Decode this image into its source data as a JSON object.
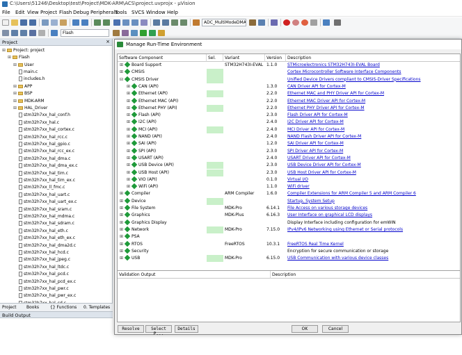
{
  "window": {
    "title": "C:\\Users\\51246\\Desktop\\test\\Project\\MDK-ARM\\ACS\\project.uvprojx - µVision"
  },
  "menu": [
    "File",
    "Edit",
    "View",
    "Project",
    "Flash",
    "Debug",
    "Peripherals",
    "Tools",
    "SVCS",
    "Window",
    "Help"
  ],
  "toolbar": {
    "target_combo": "ADC_MultiModeDMARec",
    "build_target": "Flash"
  },
  "project_panel": {
    "title": "Project",
    "tree": [
      {
        "label": "Project: project",
        "kind": "root",
        "indent": 0
      },
      {
        "label": "Flash",
        "kind": "folder",
        "indent": 1
      },
      {
        "label": "User",
        "kind": "folder",
        "indent": 2
      },
      {
        "label": "main.c",
        "kind": "file",
        "indent": 3
      },
      {
        "label": "includes.h",
        "kind": "file",
        "indent": 3
      },
      {
        "label": "APP",
        "kind": "folder",
        "indent": 2
      },
      {
        "label": "BSP",
        "kind": "folder",
        "indent": 2
      },
      {
        "label": "MDK-ARM",
        "kind": "folder",
        "indent": 2
      },
      {
        "label": "HAL_Driver",
        "kind": "folder",
        "indent": 2
      },
      {
        "label": "stm32h7xx_hal_conf.h",
        "kind": "file",
        "indent": 3
      },
      {
        "label": "stm32h7xx_hal.c",
        "kind": "file",
        "indent": 3
      },
      {
        "label": "stm32h7xx_hal_cortex.c",
        "kind": "file",
        "indent": 3
      },
      {
        "label": "stm32h7xx_hal_rcc.c",
        "kind": "file",
        "indent": 3
      },
      {
        "label": "stm32h7xx_hal_gpio.c",
        "kind": "file",
        "indent": 3
      },
      {
        "label": "stm32h7xx_hal_rcc_ex.c",
        "kind": "file",
        "indent": 3
      },
      {
        "label": "stm32h7xx_hal_dma.c",
        "kind": "file",
        "indent": 3
      },
      {
        "label": "stm32h7xx_hal_dma_ex.c",
        "kind": "file",
        "indent": 3
      },
      {
        "label": "stm32h7xx_hal_tim.c",
        "kind": "file",
        "indent": 3
      },
      {
        "label": "stm32h7xx_hal_tim_ex.c",
        "kind": "file",
        "indent": 3
      },
      {
        "label": "stm32h7xx_ll_fmc.c",
        "kind": "file",
        "indent": 3
      },
      {
        "label": "stm32h7xx_hal_uart.c",
        "kind": "file",
        "indent": 3
      },
      {
        "label": "stm32h7xx_hal_uart_ex.c",
        "kind": "file",
        "indent": 3
      },
      {
        "label": "stm32h7xx_hal_sram.c",
        "kind": "file",
        "indent": 3
      },
      {
        "label": "stm32h7xx_hal_mdma.c",
        "kind": "file",
        "indent": 3
      },
      {
        "label": "stm32h7xx_hal_sdram.c",
        "kind": "file",
        "indent": 3
      },
      {
        "label": "stm32h7xx_hal_eth.c",
        "kind": "file",
        "indent": 3
      },
      {
        "label": "stm32h7xx_hal_eth_ex.c",
        "kind": "file",
        "indent": 3
      },
      {
        "label": "stm32h7xx_hal_dma2d.c",
        "kind": "file",
        "indent": 3
      },
      {
        "label": "stm32h7xx_hal_hcd.c",
        "kind": "file",
        "indent": 3
      },
      {
        "label": "stm32h7xx_hal_jpeg.c",
        "kind": "file",
        "indent": 3
      },
      {
        "label": "stm32h7xx_hal_ltdc.c",
        "kind": "file",
        "indent": 3
      },
      {
        "label": "stm32h7xx_hal_pcd.c",
        "kind": "file",
        "indent": 3
      },
      {
        "label": "stm32h7xx_hal_pcd_ex.c",
        "kind": "file",
        "indent": 3
      },
      {
        "label": "stm32h7xx_hal_pwr.c",
        "kind": "file",
        "indent": 3
      },
      {
        "label": "stm32h7xx_hal_pwr_ex.c",
        "kind": "file",
        "indent": 3
      },
      {
        "label": "stm32h7xx_hal_sd.c",
        "kind": "file",
        "indent": 3
      }
    ],
    "tabs": [
      "Project",
      "Books",
      "{} Functions",
      "0. Templates"
    ]
  },
  "build_output": {
    "title": "Build Output"
  },
  "dialog": {
    "title": "Manage Run-Time Environment",
    "columns": [
      "Software Component",
      "Sel.",
      "Variant",
      "Version",
      "Description"
    ],
    "rows": [
      {
        "name": "Board Support",
        "level": 0,
        "pm": "+",
        "sel": "",
        "variant": "STM32H743I-EVAL",
        "combo": true,
        "version": "1.1.0",
        "desc": "STMicroelectronics STM32H743I-EVAL Board",
        "link": true
      },
      {
        "name": "CMSIS",
        "level": 0,
        "pm": "+",
        "sel": "green",
        "variant": "",
        "version": "",
        "desc": "Cortex Microcontroller Software Interface Components",
        "link": true
      },
      {
        "name": "CMSIS Driver",
        "level": 0,
        "pm": "-",
        "sel": "green",
        "variant": "",
        "version": "",
        "desc": "Unified Device Drivers compliant to CMSIS-Driver Specifications",
        "link": true
      },
      {
        "name": "CAN (API)",
        "level": 1,
        "pm": "+",
        "sel": "",
        "variant": "",
        "version": "1.3.0",
        "desc": "CAN Driver API for Cortex-M",
        "link": true
      },
      {
        "name": "Ethernet (API)",
        "level": 1,
        "pm": "+",
        "sel": "green",
        "variant": "",
        "version": "2.2.0",
        "desc": "Ethernet MAC and PHY Driver API for Cortex-M",
        "link": true
      },
      {
        "name": "Ethernet MAC (API)",
        "level": 1,
        "pm": "+",
        "sel": "",
        "variant": "",
        "version": "2.2.0",
        "desc": "Ethernet MAC Driver API for Cortex-M",
        "link": true
      },
      {
        "name": "Ethernet PHY (API)",
        "level": 1,
        "pm": "+",
        "sel": "green",
        "variant": "",
        "version": "2.2.0",
        "desc": "Ethernet PHY Driver API for Cortex-M",
        "link": true
      },
      {
        "name": "Flash (API)",
        "level": 1,
        "pm": "+",
        "sel": "",
        "variant": "",
        "version": "2.3.0",
        "desc": "Flash Driver API for Cortex-M",
        "link": true
      },
      {
        "name": "I2C (API)",
        "level": 1,
        "pm": "+",
        "sel": "",
        "variant": "",
        "version": "2.4.0",
        "desc": "I2C Driver API for Cortex-M",
        "link": true
      },
      {
        "name": "MCI (API)",
        "level": 1,
        "pm": "+",
        "sel": "green",
        "variant": "",
        "version": "2.4.0",
        "desc": "MCI Driver API for Cortex-M",
        "link": true
      },
      {
        "name": "NAND (API)",
        "level": 1,
        "pm": "+",
        "sel": "",
        "variant": "",
        "version": "2.4.0",
        "desc": "NAND Flash Driver API for Cortex-M",
        "link": true
      },
      {
        "name": "SAI (API)",
        "level": 1,
        "pm": "+",
        "sel": "",
        "variant": "",
        "version": "1.2.0",
        "desc": "SAI Driver API for Cortex-M",
        "link": true
      },
      {
        "name": "SPI (API)",
        "level": 1,
        "pm": "+",
        "sel": "",
        "variant": "",
        "version": "2.3.0",
        "desc": "SPI Driver API for Cortex-M",
        "link": true
      },
      {
        "name": "USART (API)",
        "level": 1,
        "pm": "+",
        "sel": "",
        "variant": "",
        "version": "2.4.0",
        "desc": "USART Driver API for Cortex-M",
        "link": true
      },
      {
        "name": "USB Device (API)",
        "level": 1,
        "pm": "+",
        "sel": "green",
        "variant": "",
        "version": "2.3.0",
        "desc": "USB Device Driver API for Cortex-M",
        "link": true
      },
      {
        "name": "USB Host (API)",
        "level": 1,
        "pm": "+",
        "sel": "green",
        "variant": "",
        "version": "2.3.0",
        "desc": "USB Host Driver API for Cortex-M",
        "link": true
      },
      {
        "name": "VIO (API)",
        "level": 1,
        "pm": "+",
        "sel": "",
        "variant": "",
        "version": "0.1.0",
        "desc": "Virtual I/O",
        "link": true
      },
      {
        "name": "WiFi (API)",
        "level": 1,
        "pm": "+",
        "sel": "",
        "variant": "",
        "version": "1.1.0",
        "desc": "WiFi driver",
        "link": true
      },
      {
        "name": "Compiler",
        "level": 0,
        "pm": "+",
        "sel": "",
        "variant": "ARM Compiler",
        "version": "1.6.0",
        "desc": "Compiler Extensions for ARM Compiler 5 and ARM Compiler 6",
        "link": true
      },
      {
        "name": "Device",
        "level": 0,
        "pm": "+",
        "sel": "green",
        "variant": "",
        "version": "",
        "desc": "Startup, System Setup",
        "link": true
      },
      {
        "name": "File System",
        "level": 0,
        "pm": "+",
        "sel": "",
        "variant": "MDK-Pro",
        "combo": true,
        "version": "6.14.1",
        "desc": "File Access on various storage devices",
        "link": true
      },
      {
        "name": "Graphics",
        "level": 0,
        "pm": "+",
        "sel": "",
        "variant": "MDK-Plus",
        "combo": true,
        "version": "6.16.3",
        "desc": "User Interface on graphical LCD displays",
        "link": true
      },
      {
        "name": "Graphics Display",
        "level": 0,
        "pm": "+",
        "sel": "",
        "variant": "",
        "version": "",
        "desc": "Display Interface including configuration for emWIN",
        "link": false
      },
      {
        "name": "Network",
        "level": 0,
        "pm": "+",
        "sel": "green",
        "variant": "MDK-Pro",
        "combo": true,
        "version": "7.15.0",
        "desc": "IPv4/IPv6 Networking using Ethernet or Serial protocols",
        "link": true
      },
      {
        "name": "PSA",
        "level": 0,
        "pm": "+",
        "sel": "",
        "variant": "",
        "version": "",
        "desc": "",
        "link": false
      },
      {
        "name": "RTOS",
        "level": 0,
        "pm": "+",
        "sel": "",
        "variant": "FreeRTOS",
        "version": "10.3.1",
        "desc": "FreeRTOS Real Time Kernel",
        "link": true
      },
      {
        "name": "Security",
        "level": 0,
        "pm": "+",
        "sel": "",
        "variant": "",
        "version": "",
        "desc": "Encryption for secure communication or storage",
        "link": false
      },
      {
        "name": "USB",
        "level": 0,
        "pm": "+",
        "sel": "green",
        "variant": "MDK-Pro",
        "combo": true,
        "version": "6.15.0",
        "desc": "USB Communication with various device classes",
        "link": true
      }
    ],
    "validation": {
      "col1": "Validation Output",
      "col2": "Description"
    },
    "buttons": [
      "Resolve",
      "Select P...",
      "Details",
      "OK",
      "Cancel"
    ]
  },
  "colors": {
    "selected_bg": "#c9f0c9",
    "link": "#0000cc",
    "gem": "#1f9a3a"
  }
}
